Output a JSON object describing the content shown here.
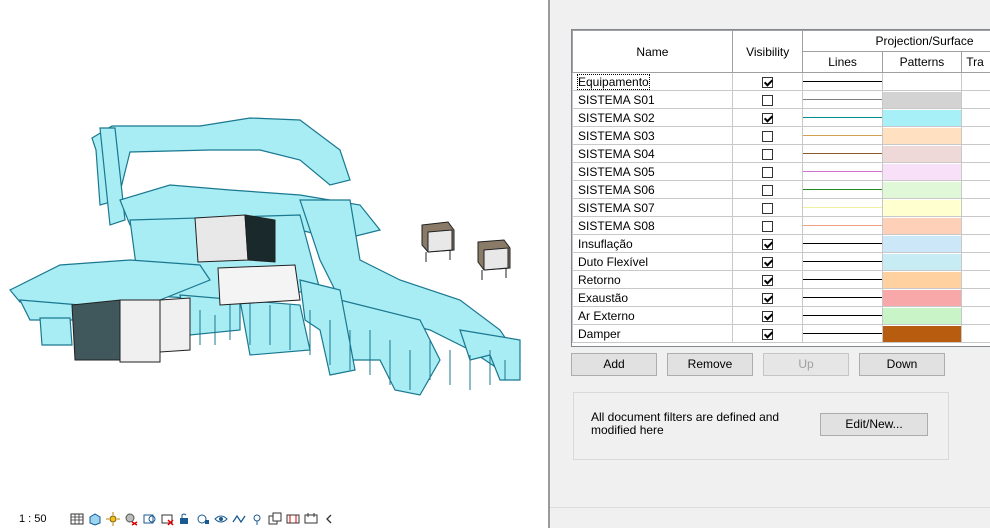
{
  "viewport": {
    "scale": "1 : 50",
    "status_icons": [
      "detail-level-icon",
      "visual-style-icon",
      "sun-path-icon",
      "shadows-icon",
      "crop-view-icon",
      "show-crop-icon",
      "unlock-3d-icon",
      "temporary-hide-icon",
      "reveal-hidden-icon",
      "analytical-model-icon",
      "highlight-displacement-icon",
      "worksharing-icon",
      "reveal-constraints-icon",
      "view-properties-icon",
      "collapse-arrow-icon"
    ]
  },
  "filters": {
    "columns": {
      "name": "Name",
      "visibility": "Visibility",
      "projection": "Projection/Surface",
      "lines": "Lines",
      "patterns": "Patterns",
      "transparency": "Tra"
    },
    "rows": [
      {
        "name": "Equipamento",
        "visible": true,
        "line_color": "#000000",
        "pattern_color": "#ffffff"
      },
      {
        "name": "SISTEMA S01",
        "visible": false,
        "line_color": "#808080",
        "pattern_color": "#d3d3d3"
      },
      {
        "name": "SISTEMA S02",
        "visible": true,
        "line_color": "#008b8b",
        "pattern_color": "#a8f0f8"
      },
      {
        "name": "SISTEMA S03",
        "visible": false,
        "line_color": "#d2a050",
        "pattern_color": "#ffe0c0"
      },
      {
        "name": "SISTEMA S04",
        "visible": false,
        "line_color": "#8b5a2b",
        "pattern_color": "#eed8d8"
      },
      {
        "name": "SISTEMA S05",
        "visible": false,
        "line_color": "#d070d0",
        "pattern_color": "#f8e0f8"
      },
      {
        "name": "SISTEMA S06",
        "visible": false,
        "line_color": "#228b22",
        "pattern_color": "#e0f8d8"
      },
      {
        "name": "SISTEMA S07",
        "visible": false,
        "line_color": "#f0f0a0",
        "pattern_color": "#ffffd0"
      },
      {
        "name": "SISTEMA S08",
        "visible": false,
        "line_color": "#f0a080",
        "pattern_color": "#ffd0b8"
      },
      {
        "name": "Insuflação",
        "visible": true,
        "line_color": "#000000",
        "pattern_color": "#cce8f8"
      },
      {
        "name": "Duto Flexível",
        "visible": true,
        "line_color": "#000000",
        "pattern_color": "#c8ecf4"
      },
      {
        "name": "Retorno",
        "visible": true,
        "line_color": "#000000",
        "pattern_color": "#ffd0a0"
      },
      {
        "name": "Exaustão",
        "visible": true,
        "line_color": "#000000",
        "pattern_color": "#f8a8a8"
      },
      {
        "name": "Ar Externo",
        "visible": true,
        "line_color": "#000000",
        "pattern_color": "#c8f4c8"
      },
      {
        "name": "Damper",
        "visible": true,
        "line_color": "#000000",
        "pattern_color": "#b85c10"
      }
    ]
  },
  "buttons": {
    "add": "Add",
    "remove": "Remove",
    "up": "Up",
    "down": "Down",
    "edit_new": "Edit/New..."
  },
  "info": {
    "text": "All document filters are defined and modified here"
  },
  "colors": {
    "duct_fill": "#a8ecf4",
    "duct_stroke": "#1a7890",
    "equipment_fill": "#40585c"
  }
}
